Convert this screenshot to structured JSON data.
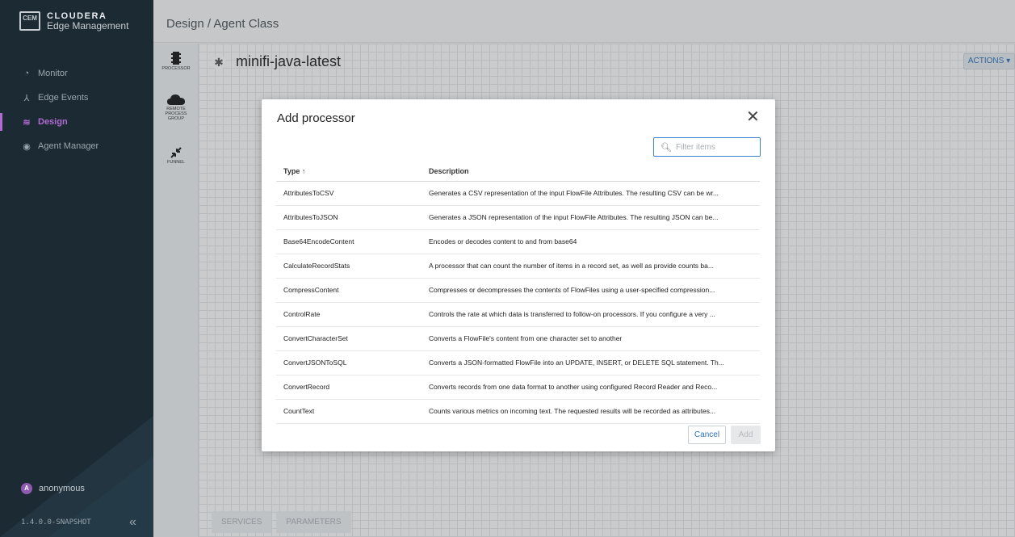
{
  "sidebar": {
    "logo_badge": "CEM",
    "company": "CLOUDERA",
    "product": "Edge Management",
    "items": [
      {
        "label": "Monitor",
        "icon": "gauge-icon"
      },
      {
        "label": "Edge Events",
        "icon": "network-icon"
      },
      {
        "label": "Design",
        "icon": "design-icon",
        "active": true
      },
      {
        "label": "Agent Manager",
        "icon": "agent-icon"
      }
    ],
    "user": {
      "avatar_letter": "A",
      "name": "anonymous"
    },
    "version": "1.4.0.0-SNAPSHOT"
  },
  "header": {
    "breadcrumb": "Design / Agent Class"
  },
  "canvas": {
    "flow_name": "minifi-java-latest",
    "actions_label": "ACTIONS ▾",
    "bottom_tabs": [
      "SERVICES",
      "PARAMETERS"
    ]
  },
  "palette": [
    {
      "label": "PROCESSOR",
      "icon": "processor-icon"
    },
    {
      "label": "REMOTE\nPROCESS\nGROUP",
      "icon": "cloud-icon"
    },
    {
      "label": "FUNNEL",
      "icon": "funnel-icon"
    }
  ],
  "modal": {
    "title": "Add processor",
    "filter_placeholder": "Filter items",
    "columns": {
      "type": "Type ↑",
      "description": "Description"
    },
    "rows": [
      {
        "type": "AttributesToCSV",
        "description": "Generates a CSV representation of the input FlowFile Attributes. The resulting CSV can be wr..."
      },
      {
        "type": "AttributesToJSON",
        "description": "Generates a JSON representation of the input FlowFile Attributes. The resulting JSON can be..."
      },
      {
        "type": "Base64EncodeContent",
        "description": "Encodes or decodes content to and from base64"
      },
      {
        "type": "CalculateRecordStats",
        "description": "A processor that can count the number of items in a record set, as well as provide counts ba..."
      },
      {
        "type": "CompressContent",
        "description": "Compresses or decompresses the contents of FlowFiles using a user-specified compression..."
      },
      {
        "type": "ControlRate",
        "description": "Controls the rate at which data is transferred to follow-on processors. If you configure a very ..."
      },
      {
        "type": "ConvertCharacterSet",
        "description": "Converts a FlowFile's content from one character set to another"
      },
      {
        "type": "ConvertJSONToSQL",
        "description": "Converts a JSON-formatted FlowFile into an UPDATE, INSERT, or DELETE SQL statement. Th..."
      },
      {
        "type": "ConvertRecord",
        "description": "Converts records from one data format to another using configured Record Reader and Reco..."
      },
      {
        "type": "CountText",
        "description": "Counts various metrics on incoming text. The requested results will be recorded as attributes..."
      }
    ],
    "cancel_label": "Cancel",
    "add_label": "Add"
  },
  "colors": {
    "sidebar_bg": "#1c2b33",
    "accent": "#b26ad3",
    "link": "#2d6fb5"
  }
}
